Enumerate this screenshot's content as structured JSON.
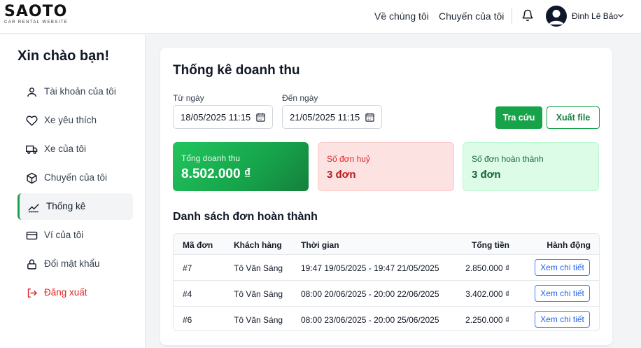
{
  "header": {
    "logo_text": "SAOTO",
    "logo_subtitle": "CAR RENTAL WEBSITE",
    "nav": [
      {
        "label": "Về chúng tôi"
      },
      {
        "label": "Chuyến của tôi"
      }
    ],
    "user_name": "Đinh Lê Bảo",
    "icons": {
      "notification": "bell-icon",
      "avatar": "user-avatar-icon",
      "menu": "chevron-down-icon"
    }
  },
  "sidebar": {
    "greeting": "Xin chào bạn!",
    "items": [
      {
        "label": "Tài khoản của tôi",
        "icon": "user-icon"
      },
      {
        "label": "Xe yêu thích",
        "icon": "heart-icon"
      },
      {
        "label": "Xe của tôi",
        "icon": "truck-icon"
      },
      {
        "label": "Chuyến của tôi",
        "icon": "box-icon"
      },
      {
        "label": "Thống kê",
        "icon": "chart-line-icon",
        "active": true
      },
      {
        "label": "Ví của tôi",
        "icon": "wallet-icon"
      },
      {
        "label": "Đổi mật khẩu",
        "icon": "lock-icon"
      },
      {
        "label": "Đăng xuất",
        "icon": "logout-icon"
      }
    ]
  },
  "main": {
    "title": "Thống kê doanh thu",
    "from_label": "Từ ngày",
    "from_value": "18/05/2025 11:15",
    "to_label": "Đến ngày",
    "to_value": "21/05/2025 11:15",
    "search_button": "Tra cứu",
    "export_button": "Xuất file",
    "stats": {
      "total_label": "Tổng doanh thu",
      "total_value": "8.502.000 ₫",
      "cancel_label": "Số đơn huỷ",
      "cancel_value": "3 đơn",
      "done_label": "Số đơn hoàn thành",
      "done_value": "3 đơn"
    },
    "table_title": "Danh sách đơn hoàn thành",
    "columns": [
      "Mã đơn",
      "Khách hàng",
      "Thời gian",
      "Tổng tiền",
      "Hành động"
    ],
    "rows": [
      {
        "id": "#7",
        "customer": "Tô Văn Sáng",
        "time": "19:47 19/05/2025 - 19:47 21/05/2025",
        "total": "2.850.000 ₫",
        "action": "Xem chi tiết"
      },
      {
        "id": "#4",
        "customer": "Tô Văn Sáng",
        "time": "08:00 20/06/2025 - 20:00 22/06/2025",
        "total": "3.402.000 ₫",
        "action": "Xem chi tiết"
      },
      {
        "id": "#6",
        "customer": "Tô Văn Sáng",
        "time": "08:00 23/06/2025 - 20:00 25/06/2025",
        "total": "2.250.000 ₫",
        "action": "Xem chi tiết"
      }
    ]
  },
  "colors": {
    "accent": "#16a34a",
    "danger": "#dc2626",
    "link": "#2563eb"
  }
}
